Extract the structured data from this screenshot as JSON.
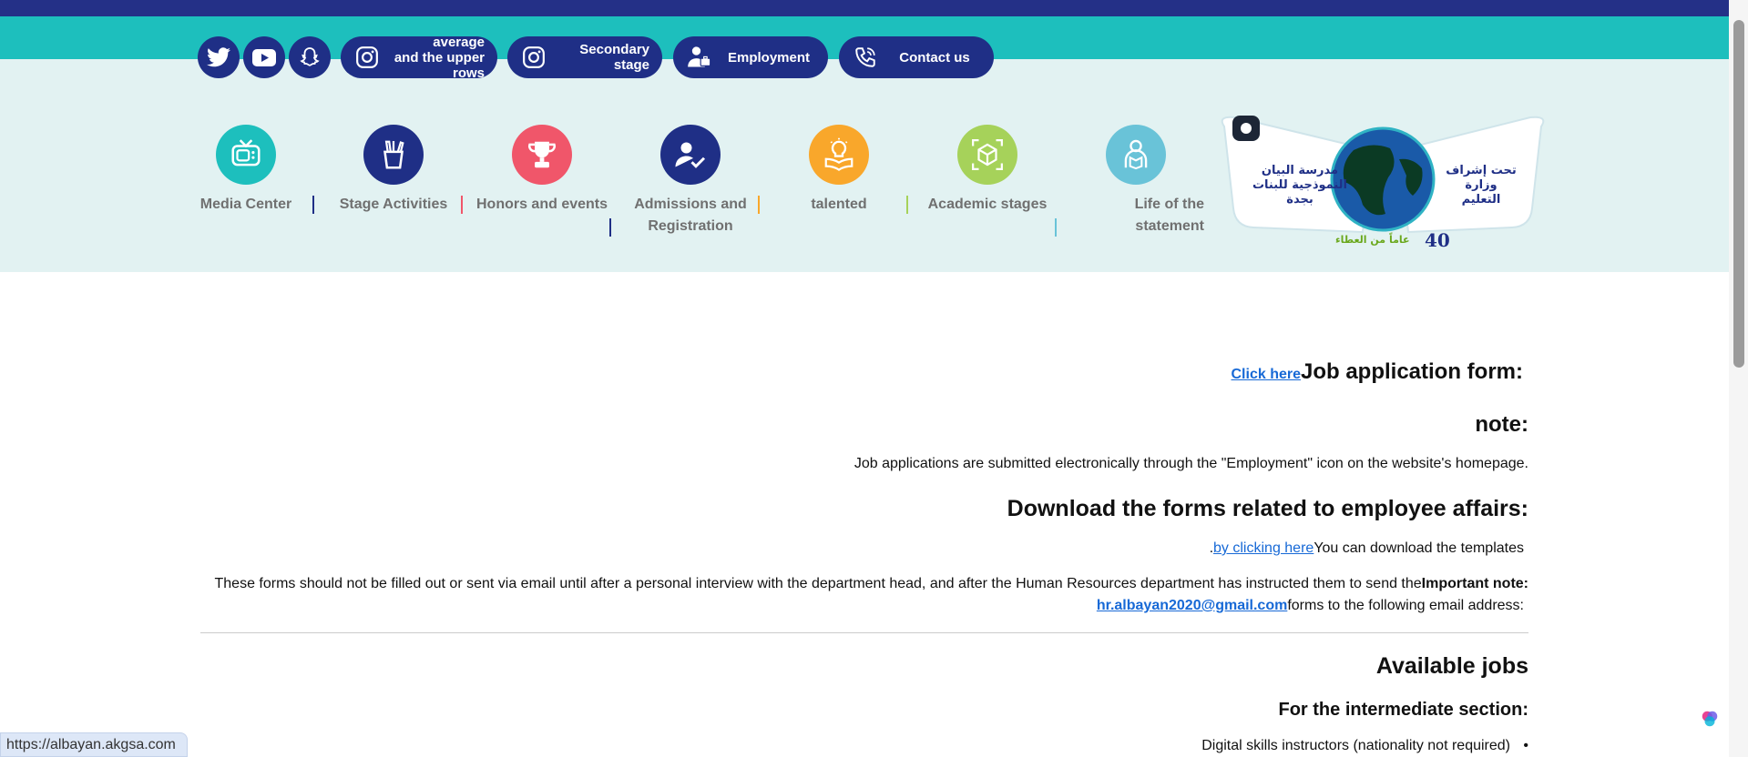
{
  "topbar": {
    "social": [
      {
        "name": "twitter-icon"
      },
      {
        "name": "youtube-icon"
      },
      {
        "name": "snapchat-icon"
      }
    ],
    "pills": [
      {
        "label": "average\nand the upper\nrows",
        "icon": "instagram-icon"
      },
      {
        "label": "Secondary\nstage",
        "icon": "instagram-icon"
      },
      {
        "label": "Employment",
        "icon": "employee-icon"
      },
      {
        "label": "Contact us",
        "icon": "phone-icon"
      }
    ]
  },
  "nav": {
    "items": [
      {
        "label": "Media Center",
        "icon": "tv-icon",
        "color": "#1dbfbd"
      },
      {
        "label": "Stage Activities",
        "icon": "pencil-cup-icon",
        "color": "#1f2f86"
      },
      {
        "label": "Honors and events",
        "icon": "trophy-icon",
        "color": "#f0566a"
      },
      {
        "label": "Admissions and Registration",
        "icon": "user-check-icon",
        "color": "#1f2f86"
      },
      {
        "label": "talented",
        "icon": "lightbulb-book-icon",
        "color": "#f9a72b"
      },
      {
        "label": "Academic stages",
        "icon": "cube-icon",
        "color": "#a6d25a"
      },
      {
        "label": "Life of the statement",
        "icon": "student-icon",
        "color": "#69c3d8"
      }
    ]
  },
  "logo": {
    "supervision": "تحت إشراف وزارة التعليم",
    "school": "مدرسة البيان النموذجية للبنات بجدة",
    "years": "40",
    "tagline": "عاماً من العطاء"
  },
  "content": {
    "job_form_title": "Job application form:",
    "job_form_link": "Click here",
    "note_title": "note:",
    "note_text": "Job applications are submitted electronically through the \"Employment\" icon on the website's homepage.",
    "download_title": "Download the forms related to employee affairs:",
    "download_text": "You can download the templates",
    "download_link": "by clicking here",
    "download_dot": ".",
    "important_label": "Important note:",
    "important_text": "These forms should not be filled out or sent via email until after a personal interview with the department head, and after the Human Resources department has instructed them to send the",
    "email_text": "forms to the following email address:",
    "email_link": "hr.albayan2020@gmail.com",
    "jobs_title": "Available jobs",
    "intermediate_title": "For the intermediate section:",
    "job_items": [
      "Digital skills instructors (nationality not required)"
    ]
  },
  "status_url": "https://albayan.akgsa.com"
}
